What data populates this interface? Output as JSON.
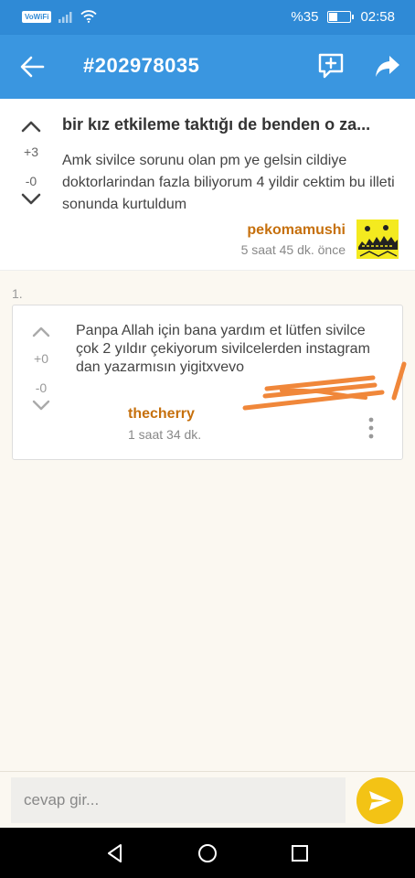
{
  "status_bar": {
    "vowifi_label": "VoWiFi",
    "battery_text": "%35",
    "battery_level": 0.35,
    "time": "02:58"
  },
  "app_bar": {
    "title": "#202978035"
  },
  "post": {
    "upvotes": "+3",
    "downvotes": "-0",
    "title": "bir kız etkileme taktığı de benden o za...",
    "content": "Amk sivilce sorunu olan pm ye gelsin cildiye doktorlarindan fazla biliyorum 4 yildir cektim bu illeti sonunda kurtuldum",
    "author": "pekomamushi",
    "time": "5 saat 45 dk. önce"
  },
  "replies": [
    {
      "index": "1.",
      "upvotes": "+0",
      "downvotes": "-0",
      "content": "Panpa Allah için bana yardım et lütfen sivilce çok 2 yıldır çekiyorum sivilcelerden instagram dan yazarmısın yigitxvevo",
      "author": "thecherry",
      "time": "1 saat 34 dk."
    }
  ],
  "bottom_input": {
    "placeholder": "cevap gir..."
  },
  "colors": {
    "app_bar": "#3a96e0",
    "status_bar": "#2f8ad6",
    "author": "#c6700d",
    "send_button": "#f3c315",
    "scribble": "#f0873a"
  }
}
